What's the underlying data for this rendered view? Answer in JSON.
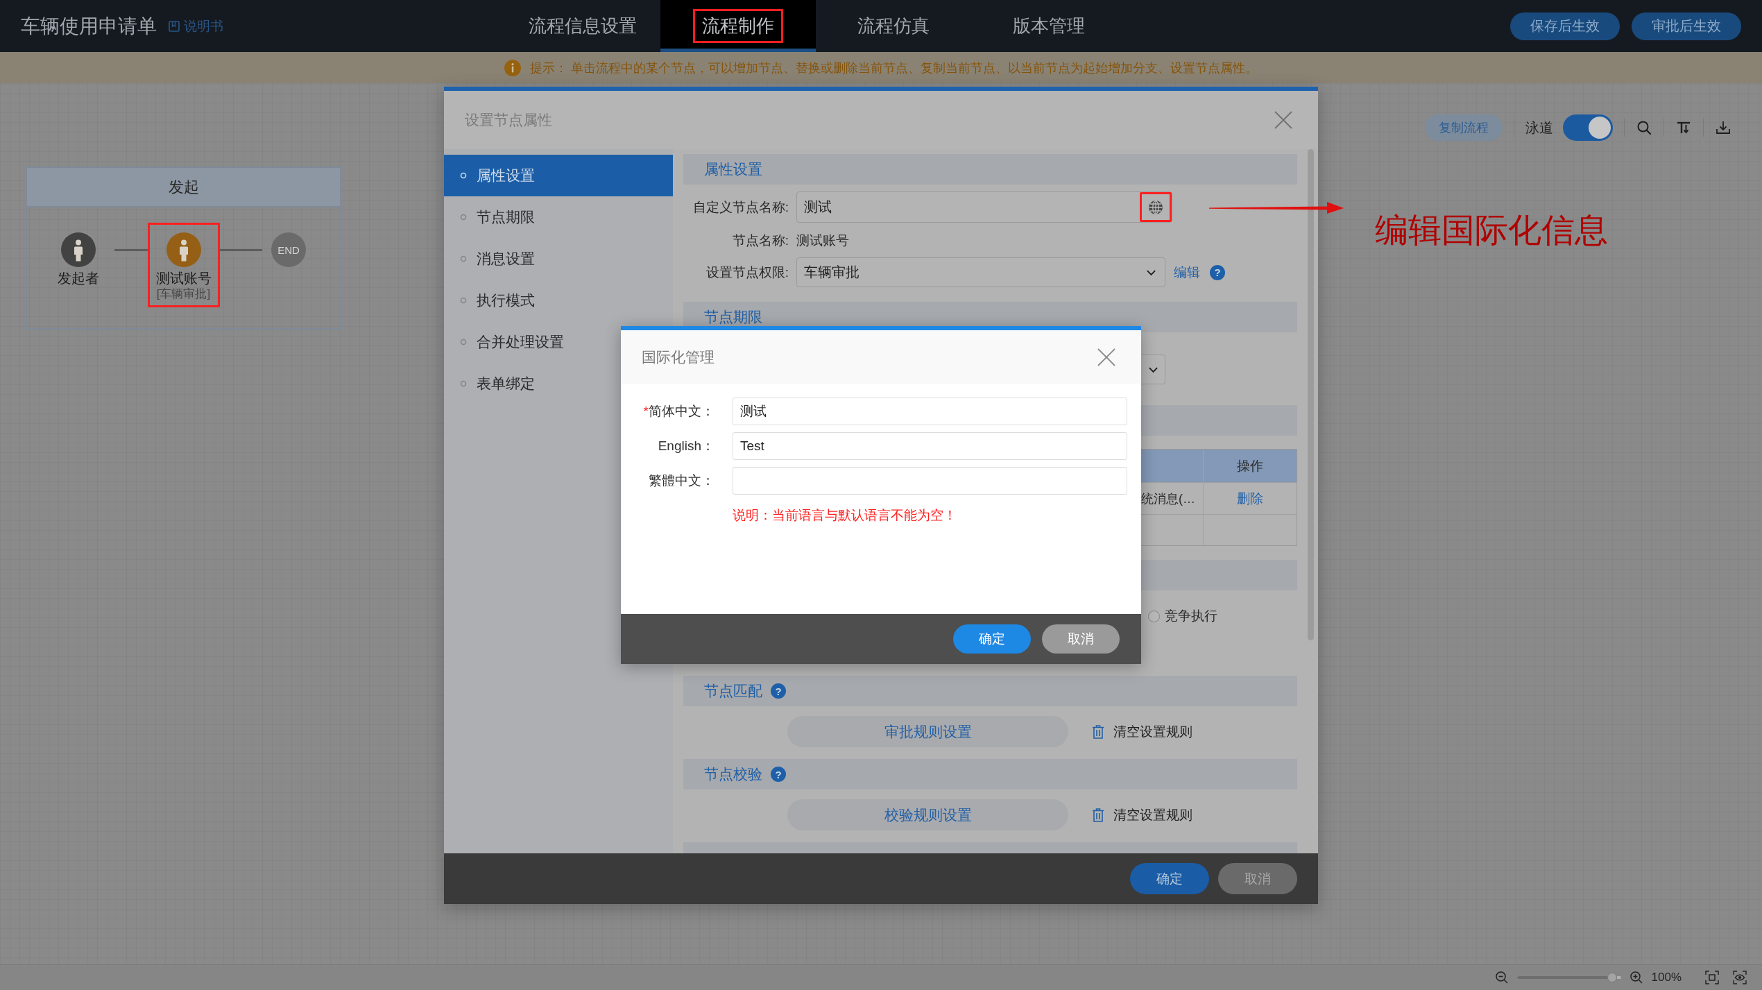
{
  "header": {
    "title": "车辆使用申请单",
    "manual_link": "说明书",
    "tabs": [
      {
        "label": "流程信息设置",
        "selected": false,
        "highlighted": false
      },
      {
        "label": "流程制作",
        "selected": true,
        "highlighted": true
      },
      {
        "label": "流程仿真",
        "selected": false,
        "highlighted": false
      },
      {
        "label": "版本管理",
        "selected": false,
        "highlighted": false
      }
    ],
    "buttons": [
      "保存后生效",
      "审批后生效"
    ]
  },
  "tip": {
    "text": "提示： 单击流程中的某个节点，可以增加节点、替换或删除当前节点、复制当前节点、以当前节点为起始增加分支、设置节点属性。"
  },
  "canvas": {
    "lane": {
      "title": "发起",
      "nodes": [
        {
          "kind": "initiator",
          "label": "发起者",
          "highlighted": false
        },
        {
          "kind": "approver",
          "label": "测试账号",
          "sublabel": "[车辆审批]",
          "highlighted": true
        },
        {
          "kind": "end",
          "label": "END",
          "highlighted": false
        }
      ]
    },
    "toolbar": {
      "copy_button": "复制流程",
      "swimlane": {
        "label": "泳道",
        "on": true
      }
    }
  },
  "property_dialog": {
    "title": "设置节点属性",
    "nav": [
      {
        "label": "属性设置",
        "selected": true
      },
      {
        "label": "节点期限",
        "selected": false
      },
      {
        "label": "消息设置",
        "selected": false
      },
      {
        "label": "执行模式",
        "selected": false
      },
      {
        "label": "合并处理设置",
        "selected": false
      },
      {
        "label": "表单绑定",
        "selected": false
      }
    ],
    "attributes": {
      "heading": "属性设置",
      "custom_name": {
        "label": "自定义节点名称:",
        "value": "测试",
        "translate_highlighted": true
      },
      "node_name": {
        "label": "节点名称:",
        "value": "测试账号"
      },
      "permission": {
        "label": "设置节点权限:",
        "value": "车辆审批",
        "edit_link": "编辑",
        "help": "?"
      }
    },
    "deadline": {
      "heading": "节点期限"
    },
    "messages": {
      "table": {
        "action_column": "操作",
        "rows": [
          {
            "column_1": "统消息(…",
            "action": "删除"
          }
        ]
      }
    },
    "execution": {
      "options": [
        {
          "label": "竞争执行",
          "selected": false
        }
      ]
    },
    "matching": {
      "heading": "节点匹配",
      "help": "?",
      "rule_button": "审批规则设置",
      "clear_button": "清空设置规则"
    },
    "validation": {
      "heading": "节点校验",
      "help": "?",
      "rule_button": "校验规则设置",
      "clear_button": "清空设置规则"
    },
    "buttons": [
      {
        "label": "确定",
        "kind": "primary"
      },
      {
        "label": "取消",
        "kind": "secondary"
      }
    ]
  },
  "i18n_dialog": {
    "title": "国际化管理",
    "fields": [
      {
        "mark": "*",
        "label": "简体中文：",
        "value": "测试"
      },
      {
        "label": "English：",
        "value": "Test"
      },
      {
        "label": "繁體中文："
      }
    ],
    "note": "说明：当前语言与默认语言不能为空！",
    "buttons": [
      {
        "label": "确定",
        "kind": "primary"
      },
      {
        "label": "取消",
        "kind": "secondary"
      }
    ]
  },
  "annotation": {
    "text": "编辑国际化信息"
  },
  "status_bar": {
    "zoom": {
      "level": 0.96,
      "reading": "100%"
    }
  }
}
